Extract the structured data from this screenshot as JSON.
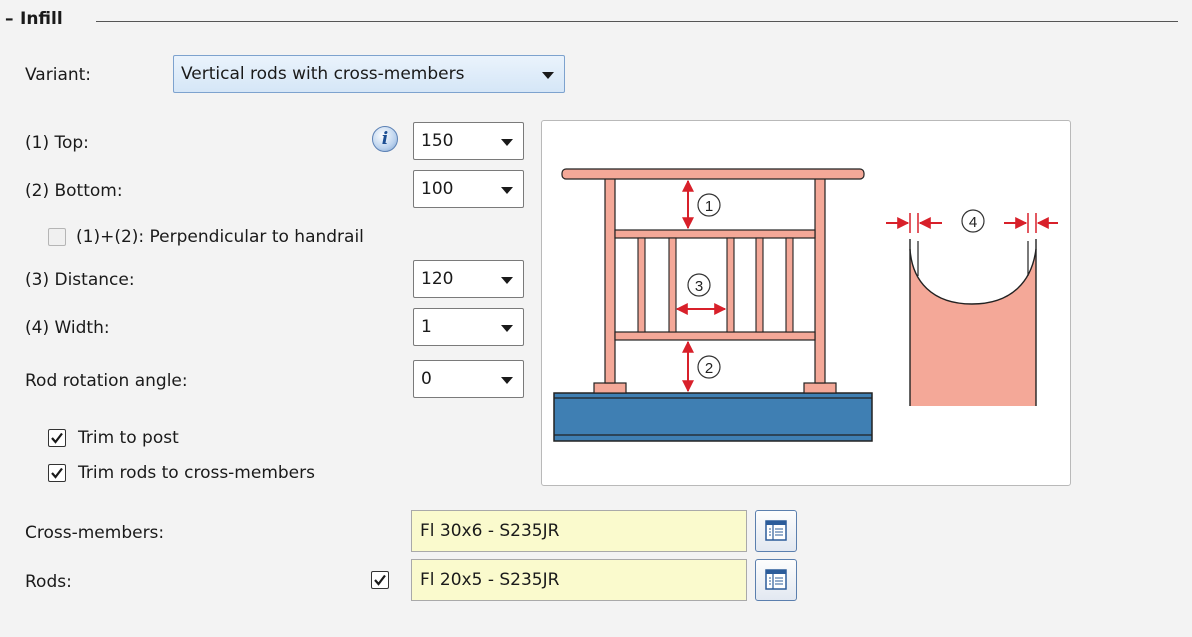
{
  "group": {
    "title": "Infill",
    "collapse_glyph": "–"
  },
  "variant": {
    "label": "Variant:",
    "value": "Vertical rods with cross-members"
  },
  "fields": {
    "top": {
      "label": "(1) Top:",
      "value": "150"
    },
    "bottom": {
      "label": "(2) Bottom:",
      "value": "100"
    },
    "perpendicular": {
      "label": "(1)+(2): Perpendicular to handrail",
      "checked": false
    },
    "distance": {
      "label": "(3) Distance:",
      "value": "120"
    },
    "width": {
      "label": "(4) Width:",
      "value": "1"
    },
    "rotation": {
      "label": "Rod rotation angle:",
      "value": "0"
    }
  },
  "options": {
    "trim_post": {
      "label": "Trim to post",
      "checked": true
    },
    "trim_rods": {
      "label": "Trim rods to cross-members",
      "checked": true
    }
  },
  "materials": {
    "cross_members": {
      "label": "Cross-members:",
      "value": "Fl 30x6 - S235JR"
    },
    "rods": {
      "label": "Rods:",
      "value": "Fl 20x5 - S235JR",
      "checked": true
    }
  },
  "diagram": {
    "markers": [
      "1",
      "2",
      "3",
      "4"
    ]
  },
  "colors": {
    "rail_fill": "#f4a898",
    "rail_stroke": "#222222",
    "beam_fill": "#3f7fb3",
    "dim_red": "#d8202a"
  }
}
